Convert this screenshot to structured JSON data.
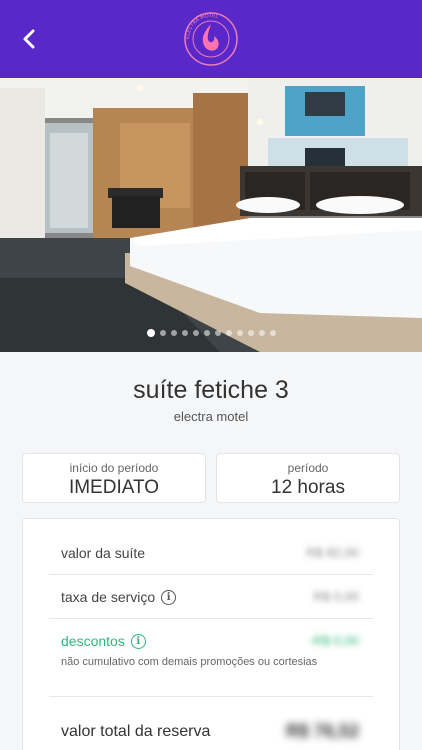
{
  "header": {
    "back_icon": "chevron-left-icon",
    "logo": {
      "text": "ELECTRA MOTEL",
      "icon": "flame-logo"
    },
    "bg_color": "#5a27c8"
  },
  "gallery": {
    "photo": "hotel-suite-bedroom",
    "total_images": 12,
    "active_index": 0
  },
  "suite": {
    "name": "suíte fetiche 3",
    "motel": "electra motel"
  },
  "booking": {
    "start_label": "início do período",
    "start_value": "IMEDIATO",
    "period_label": "período",
    "period_value": "12 horas"
  },
  "pricing": {
    "suite_value_label": "valor da suíte",
    "suite_value": "R$ 82,00",
    "service_fee_label": "taxa de serviço",
    "service_fee": "R$ 0,00",
    "discounts_label": "descontos",
    "discounts": "-R$ 0,00",
    "discounts_note": "não cumulativo com demais promoções ou cortesias",
    "total_label": "valor total da reserva",
    "total": "R$ 76,52",
    "accent_green": "#2eb67d"
  }
}
